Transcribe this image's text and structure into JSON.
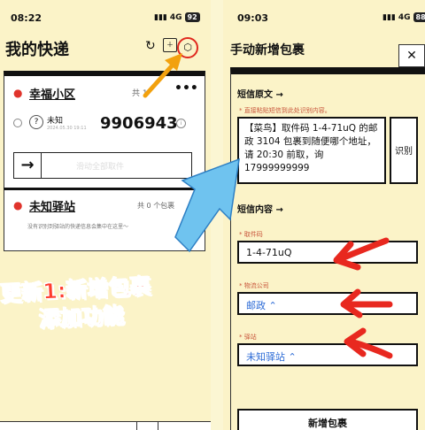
{
  "left": {
    "time": "08:22",
    "network": "4G",
    "battery": "92",
    "title": "我的快递",
    "card1": {
      "name": "幸福小区",
      "count_prefix": "共",
      "count": "1",
      "package_status": "未知",
      "package_date": "2024.05.30 19:11",
      "package_code": "9906943",
      "pickup_all": "滑动全部取件"
    },
    "card2": {
      "name": "未知驿站",
      "count_prefix": "共",
      "count": "0",
      "count_suffix": "个包裹",
      "empty_text": "没有识别到驿站的快递信息会集中在这里～"
    }
  },
  "right": {
    "time": "09:03",
    "network": "4G",
    "battery": "88",
    "title": "手动新增包裹",
    "sms_section": "短信原文",
    "sms_hint": "* 直接粘贴短信到此处识别内容。",
    "sms_text": "【菜鸟】取件码 1-4-71uQ 的邮政 3104 包裹到随便哪个地址，请 20:30 前取，询 17999999999",
    "recognize_button": "识别",
    "content_section": "短信内容",
    "code_label": "* 取件码",
    "code_value": "1-4-71uQ",
    "company_label": "* 物流公司",
    "company_value": "邮政 ⌃",
    "station_label": "* 驿站",
    "station_value": "未知驿站 ⌃",
    "add_button": "新增包裹"
  },
  "overlay": {
    "line1": "更新1:新增包裹",
    "line2": "添加功能"
  },
  "colors": {
    "background": "#fbf3c8",
    "accent_red": "#e8281f",
    "arrow_orange": "#f2a10e",
    "arrow_blue": "#5fb8ea"
  }
}
